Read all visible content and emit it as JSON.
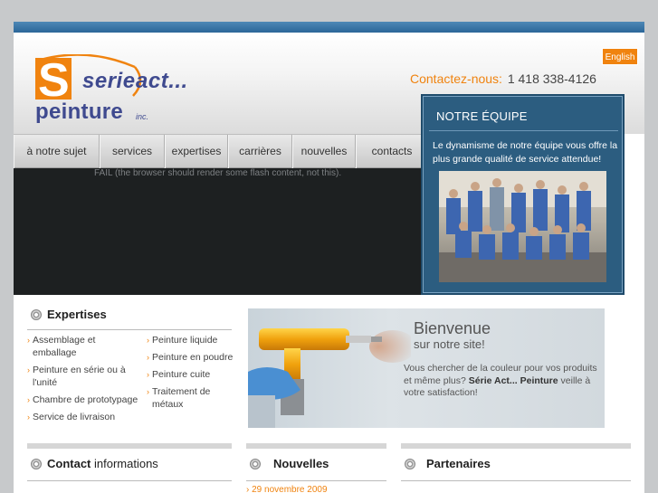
{
  "header": {
    "logo": {
      "serie": "serie",
      "act": "act...",
      "peinture": "peinture",
      "inc": "inc."
    },
    "lang_button": "English",
    "contact_label": "Contactez-nous:",
    "contact_phone": "1 418 338-4126"
  },
  "nav": {
    "items": [
      {
        "label": "à notre sujet"
      },
      {
        "label": "services"
      },
      {
        "label": "expertises"
      },
      {
        "label": "carrières"
      },
      {
        "label": "nouvelles"
      },
      {
        "label": "contacts"
      }
    ]
  },
  "flash": {
    "fail_text": "FAIL (the browser should render some flash content, not this)."
  },
  "team": {
    "title": "NOTRE ÉQUIPE",
    "text": "Le dynamisme de notre équipe vous offre la plus grande qualité de service attendue!"
  },
  "expertises": {
    "heading": "Expertises",
    "left_items": [
      "Assemblage et emballage",
      "Peinture en série ou à l'unité",
      "Chambre de prototypage",
      "Service de livraison"
    ],
    "right_items": [
      "Peinture liquide",
      "Peinture en poudre",
      "Peinture cuite",
      "Traitement de métaux"
    ]
  },
  "welcome": {
    "title": "Bienvenue",
    "subtitle": "sur notre site!",
    "text_before": "Vous chercher de la couleur pour vos produits et même plus? ",
    "brand": "Série Act... Peinture",
    "text_after": " veille à votre satisfaction!"
  },
  "sections": {
    "contact_bold": "Contact",
    "contact_rest": " informations",
    "news": "Nouvelles",
    "partners": "Partenaires",
    "news_date": "29 novembre 2009"
  },
  "colors": {
    "accent_orange": "#f0830f",
    "team_blue": "#2c5d80",
    "logo_blue": "#3f4a8f",
    "stripe_blue": "#3a77a8"
  }
}
